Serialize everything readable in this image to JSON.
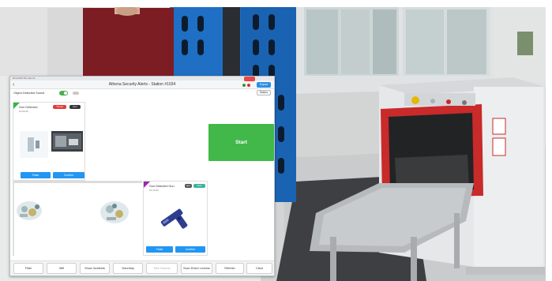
{
  "app": {
    "status_bar": "10:12 AM  Thu Jan 11",
    "title": "Athena Security Alerts - Station #1034",
    "top_button": "Export",
    "toggle_label": "Object Detected Sound",
    "status_button": "Status",
    "start_button": "Start"
  },
  "panels": [
    {
      "title": "Gun Detected",
      "time": "10:06:26",
      "badge1": "Threat",
      "badge2": "Gun",
      "false_label": "False",
      "confirm_label": "Confirm"
    },
    {
      "title": "Gun Detected Gun",
      "time": "10:10:33",
      "badge1": "gun",
      "badge2": "Gun",
      "false_label": "False",
      "confirm_label": "Confirm"
    }
  ],
  "toolbar": [
    {
      "label": "Filter",
      "enabled": true
    },
    {
      "label": "Wifi",
      "enabled": true
    },
    {
      "label": "Show Incidents",
      "enabled": true
    },
    {
      "label": "Voluntary",
      "enabled": true
    },
    {
      "label": "Tare Ground",
      "enabled": false
    },
    {
      "label": "Scan Driver License",
      "enabled": true
    },
    {
      "label": "Refresh",
      "enabled": true
    },
    {
      "label": "Clear",
      "enabled": true
    }
  ],
  "colors": {
    "start": "#42b84a",
    "blue_button": "#2196f3",
    "machine_red": "#c92a2a",
    "tower_blue": "#1f6fc5"
  }
}
